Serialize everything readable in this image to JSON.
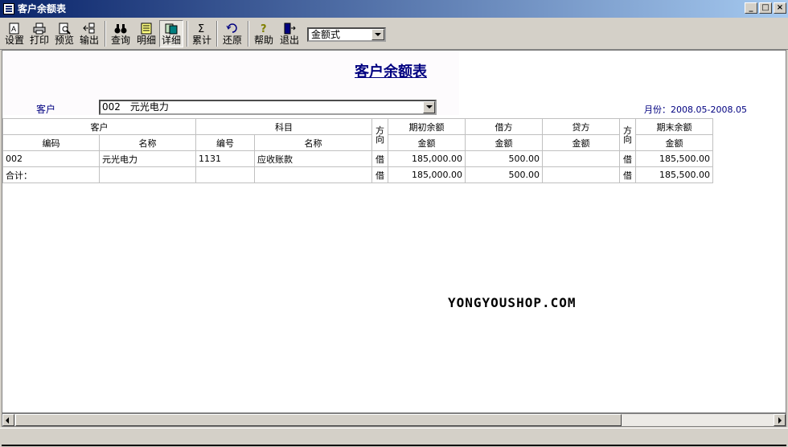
{
  "window": {
    "title": "客户余额表"
  },
  "toolbar": {
    "buttons": [
      "设置",
      "打印",
      "预览",
      "输出",
      "查询",
      "明细",
      "详细",
      "累计",
      "还原",
      "帮助",
      "退出"
    ],
    "format_select": "金额式"
  },
  "report": {
    "title": "客户余额表",
    "customer_label": "客户",
    "customer_value": "002　元光电力",
    "month": "月份：2008.05-2008.05"
  },
  "table": {
    "headers": {
      "customer": "客户",
      "subject": "科目",
      "direction": "方向",
      "opening": "期初余额",
      "debit": "借方",
      "credit": "贷方",
      "direction2": "方向",
      "closing": "期末余额",
      "code": "编码",
      "name": "名称",
      "subject_code": "编号",
      "subject_name": "名称",
      "amount": "金额"
    },
    "rows": [
      {
        "code": "002",
        "name": "元光电力",
        "subject_code": "1131",
        "subject_name": "应收账款",
        "dir": "借",
        "opening": "185,000.00",
        "debit": "500.00",
        "credit": "",
        "dir2": "借",
        "closing": "185,500.00"
      },
      {
        "code": "合计：",
        "name": "",
        "subject_code": "",
        "subject_name": "",
        "dir": "借",
        "opening": "185,000.00",
        "debit": "500.00",
        "credit": "",
        "dir2": "借",
        "closing": "185,500.00"
      }
    ]
  },
  "watermark": "YONGYOUSHOP.COM",
  "colors": {
    "titlebar": "#0a246a",
    "accent_text": "#000080"
  },
  "icons": [
    "settings-icon",
    "print-icon",
    "preview-icon",
    "export-icon",
    "query-icon",
    "detail-icon",
    "expand-detail-icon",
    "sum-icon",
    "restore-icon",
    "help-icon",
    "exit-icon"
  ]
}
